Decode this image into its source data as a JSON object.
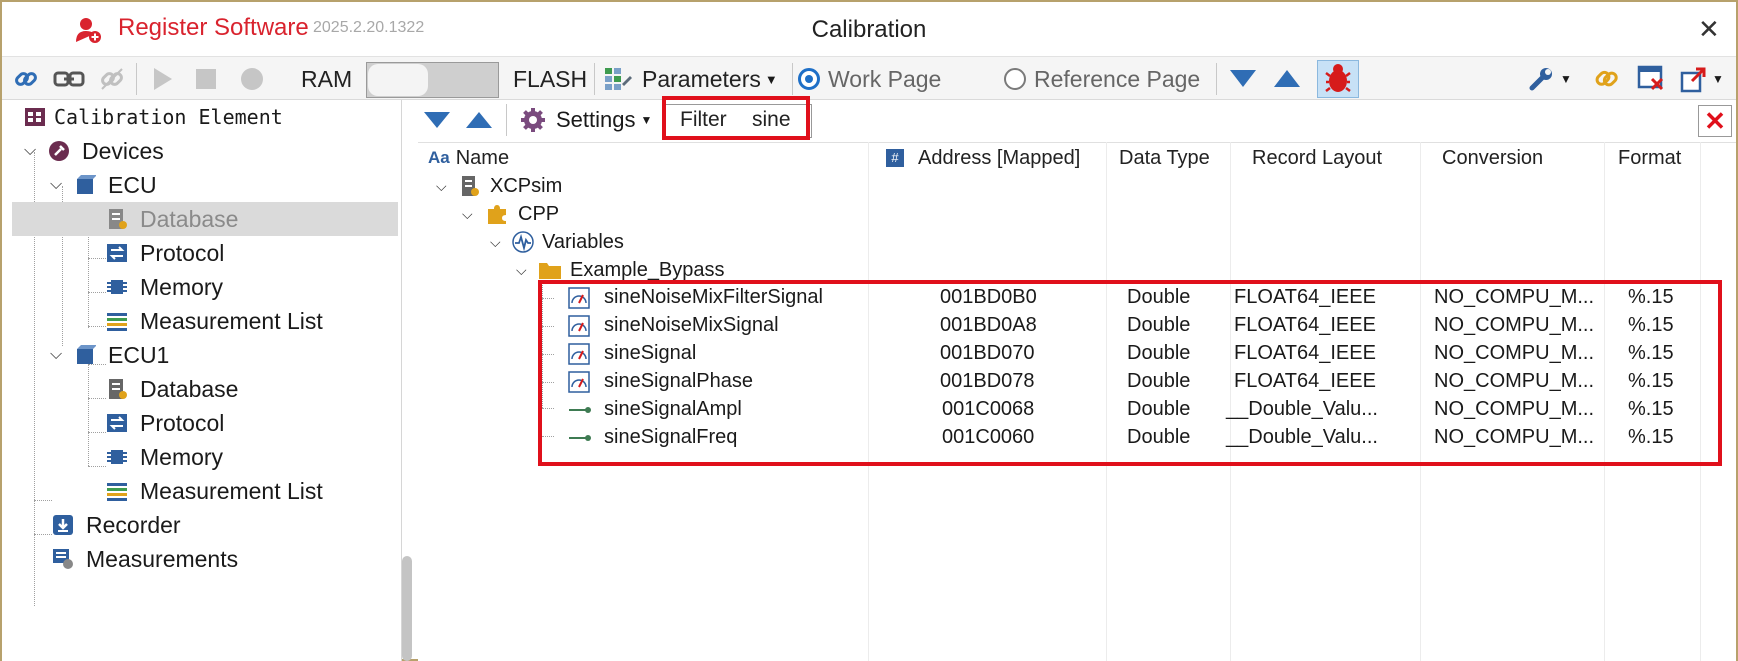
{
  "title_bar": {
    "app_name": "Register Software",
    "version": "2025.2.20.1322",
    "window_title": "Calibration",
    "close_glyph": "✕"
  },
  "toolbar": {
    "ram_label": "RAM",
    "flash_label": "FLASH",
    "parameters_label": "Parameters",
    "work_page_label": "Work Page",
    "reference_page_label": "Reference Page",
    "work_page_selected": true
  },
  "left_tree": {
    "header": "Calibration Element",
    "items": [
      {
        "label": "Devices"
      },
      {
        "label": "ECU"
      },
      {
        "label": "Database"
      },
      {
        "label": "Protocol"
      },
      {
        "label": "Memory"
      },
      {
        "label": "Measurement List"
      },
      {
        "label": "ECU1"
      },
      {
        "label": "Database"
      },
      {
        "label": "Protocol"
      },
      {
        "label": "Memory"
      },
      {
        "label": "Measurement List"
      },
      {
        "label": "Recorder"
      },
      {
        "label": "Measurements"
      }
    ]
  },
  "right_panel": {
    "settings_label": "Settings",
    "filter_label": "Filter",
    "filter_value": "sine",
    "columns": {
      "name": "Name",
      "name_prefix": "Aa",
      "address": "Address [Mapped]",
      "data_type": "Data Type",
      "record_layout": "Record Layout",
      "conversion": "Conversion",
      "format": "Format"
    },
    "tree": {
      "root": "XCPsim",
      "module": "CPP",
      "group": "Variables",
      "folder": "Example_Bypass"
    },
    "rows": [
      {
        "name": "sineNoiseMixFilterSignal",
        "address": "001BD0B0",
        "data_type": "Double",
        "record_layout": "FLOAT64_IEEE",
        "conversion": "NO_COMPU_M...",
        "format": "%.15",
        "kind": "gauge"
      },
      {
        "name": "sineNoiseMixSignal",
        "address": "001BD0A8",
        "data_type": "Double",
        "record_layout": "FLOAT64_IEEE",
        "conversion": "NO_COMPU_M...",
        "format": "%.15",
        "kind": "gauge"
      },
      {
        "name": "sineSignal",
        "address": "001BD070",
        "data_type": "Double",
        "record_layout": "FLOAT64_IEEE",
        "conversion": "NO_COMPU_M...",
        "format": "%.15",
        "kind": "gauge"
      },
      {
        "name": "sineSignalPhase",
        "address": "001BD078",
        "data_type": "Double",
        "record_layout": "FLOAT64_IEEE",
        "conversion": "NO_COMPU_M...",
        "format": "%.15",
        "kind": "gauge"
      },
      {
        "name": "sineSignalAmpl",
        "address": "001C0068",
        "data_type": "Double",
        "record_layout": "__Double_Valu...",
        "conversion": "NO_COMPU_M...",
        "format": "%.15",
        "kind": "param"
      },
      {
        "name": "sineSignalFreq",
        "address": "001C0060",
        "data_type": "Double",
        "record_layout": "__Double_Valu...",
        "conversion": "NO_COMPU_M...",
        "format": "%.15",
        "kind": "param"
      }
    ]
  },
  "colors": {
    "accent_red": "#e0101b",
    "brand_red": "#d9232e",
    "blue": "#1e6fc7",
    "selection_gray": "#dadada"
  }
}
